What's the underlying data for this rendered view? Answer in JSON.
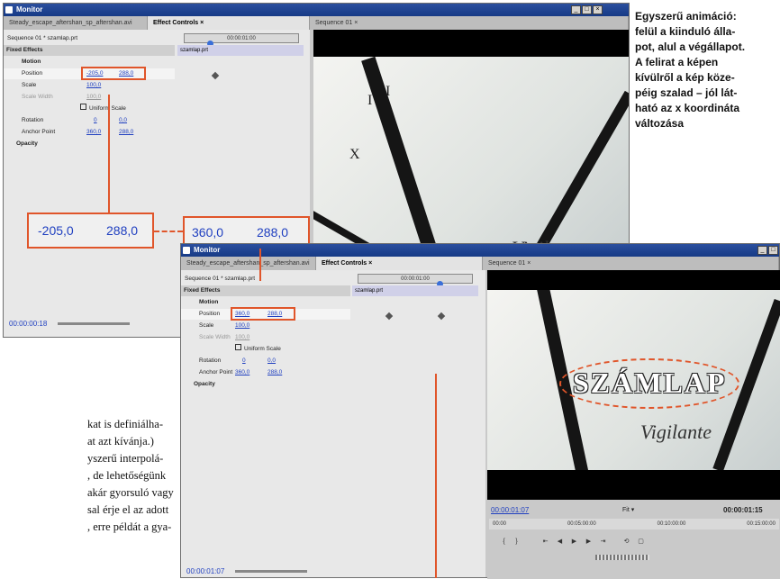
{
  "caption": [
    "Egyszerű animáció:",
    "felül a kiinduló álla-",
    "pot, alul a végállapot.",
    "A felirat a képen",
    "kívülről a kép köze-",
    "péig szalad – jól lát-",
    "ható az x koordináta",
    "változása"
  ],
  "body_text": [
    "kat is definiálha-",
    "at azt kívánja.)",
    "yszerű interpolá-",
    ", de lehetőségünk",
    "akár gyorsuló vagy",
    "sal érje el az adott",
    ", erre példát a gya-"
  ],
  "window1": {
    "title": "Monitor",
    "tabs": [
      "Steady_escape_aftershan_sp_aftershan.avi",
      "Effect Controls ×",
      "Sequence 01 ×"
    ],
    "sequence_label": "Sequence 01 * szamlap.prt",
    "timecode": "00:00:01:00",
    "clip_label": "szamlap.prt",
    "fixed_effects": "Fixed Effects",
    "motion": "Motion",
    "position_label": "Position",
    "position_x": "-205,0",
    "position_y": "288,0",
    "scale_label": "Scale",
    "scale_value": "100,0",
    "scale_width_label": "Scale Width",
    "scale_width_value": "100,0",
    "uniform_scale": "Uniform Scale",
    "rotation_label": "Rotation",
    "rotation_a": "0",
    "rotation_b": "0,0",
    "anchor_label": "Anchor Point",
    "anchor_x": "360,0",
    "anchor_y": "288,0",
    "opacity": "Opacity",
    "bottom_tc": "00:00:00:18",
    "numerals": [
      "I",
      "I",
      "X"
    ],
    "script_text": "Vigilante"
  },
  "zoom": {
    "start_x": "-205,0",
    "start_y": "288,0",
    "end_x": "360,0",
    "end_y": "288,0"
  },
  "window2": {
    "title": "Monitor",
    "tabs": [
      "Steady_escape_aftershan_sp_aftershan.avi",
      "Effect Controls ×",
      "Sequence 01 ×"
    ],
    "sequence_label": "Sequence 01 * szamlap.prt",
    "timecode": "00:00:01:00",
    "clip_label": "szamlap.prt",
    "fixed_effects": "Fixed Effects",
    "motion": "Motion",
    "position_label": "Position",
    "position_x": "360,0",
    "position_y": "288,0",
    "scale_label": "Scale",
    "scale_value": "100,0",
    "scale_width_label": "Scale Width",
    "scale_width_value": "100,0",
    "uniform_scale": "Uniform Scale",
    "rotation_label": "Rotation",
    "rotation_a": "0",
    "rotation_b": "0,0",
    "anchor_label": "Anchor Point",
    "anchor_x": "360,0",
    "anchor_y": "288,0",
    "opacity": "Opacity",
    "bottom_tc": "00:00:01:07",
    "title_text": "SZÁMLAP",
    "script_text": "Vigilante",
    "viewer_tc": "00:00:01:07",
    "viewer_end_tc": "00:00:01:15",
    "fit": "Fit",
    "ruler_ticks": [
      "00:00",
      "00:05:00:00",
      "00:10:00:00",
      "00:15:00:00"
    ]
  }
}
